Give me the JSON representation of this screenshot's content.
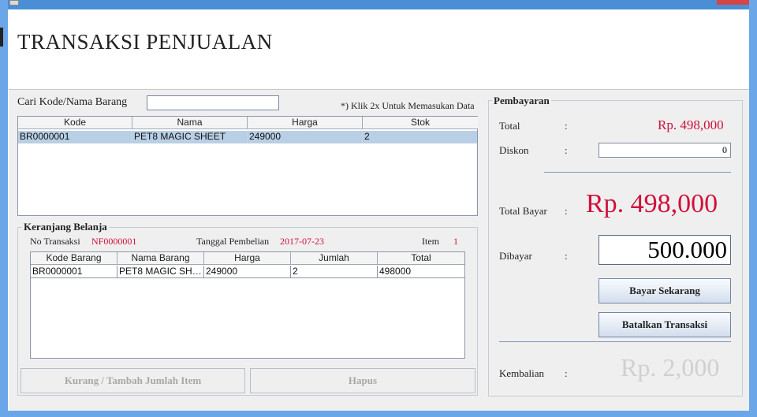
{
  "window": {
    "title": "TRANSAKSI PENJUALAN"
  },
  "search": {
    "label": "Cari Kode/Nama Barang",
    "value": "",
    "hint": "*) Klik 2x Untuk Memasukan Data"
  },
  "product_table": {
    "columns": [
      "Kode",
      "Nama",
      "Harga",
      "Stok"
    ],
    "rows": [
      [
        "BR0000001",
        "PET8 MAGIC SHEET",
        "249000",
        "2"
      ]
    ]
  },
  "cart": {
    "title": "Keranjang Belanja",
    "no_transaksi_label": "No Transaksi",
    "no_transaksi_value": "NF0000001",
    "tanggal_label": "Tanggal Pembelian",
    "tanggal_value": "2017-07-23",
    "item_label": "Item",
    "item_value": "1",
    "columns": [
      "Kode Barang",
      "Nama Barang",
      "Harga",
      "Jumlah",
      "Total"
    ],
    "rows": [
      [
        "BR0000001",
        "PET8 MAGIC SHE...",
        "249000",
        "2",
        "498000"
      ]
    ],
    "btn_adjust": "Kurang / Tambah Jumlah Item",
    "btn_delete": "Hapus"
  },
  "payment": {
    "title": "Pembayaran",
    "colon": ":",
    "total_label": "Total",
    "total_value": "Rp.  498,000",
    "diskon_label": "Diskon",
    "diskon_value": "0",
    "total_bayar_label": "Total Bayar",
    "total_bayar_value": "Rp.  498,000",
    "dibayar_label": "Dibayar",
    "dibayar_value": "500.000",
    "btn_pay": "Bayar Sekarang",
    "btn_cancel": "Batalkan Transaksi",
    "kembalian_label": "Kembalian",
    "kembalian_value": "Rp. 2,000"
  },
  "colors": {
    "accent_red": "#d0103a",
    "frame_blue": "#6aa6e8",
    "muted_gray": "#d0d0d0"
  }
}
